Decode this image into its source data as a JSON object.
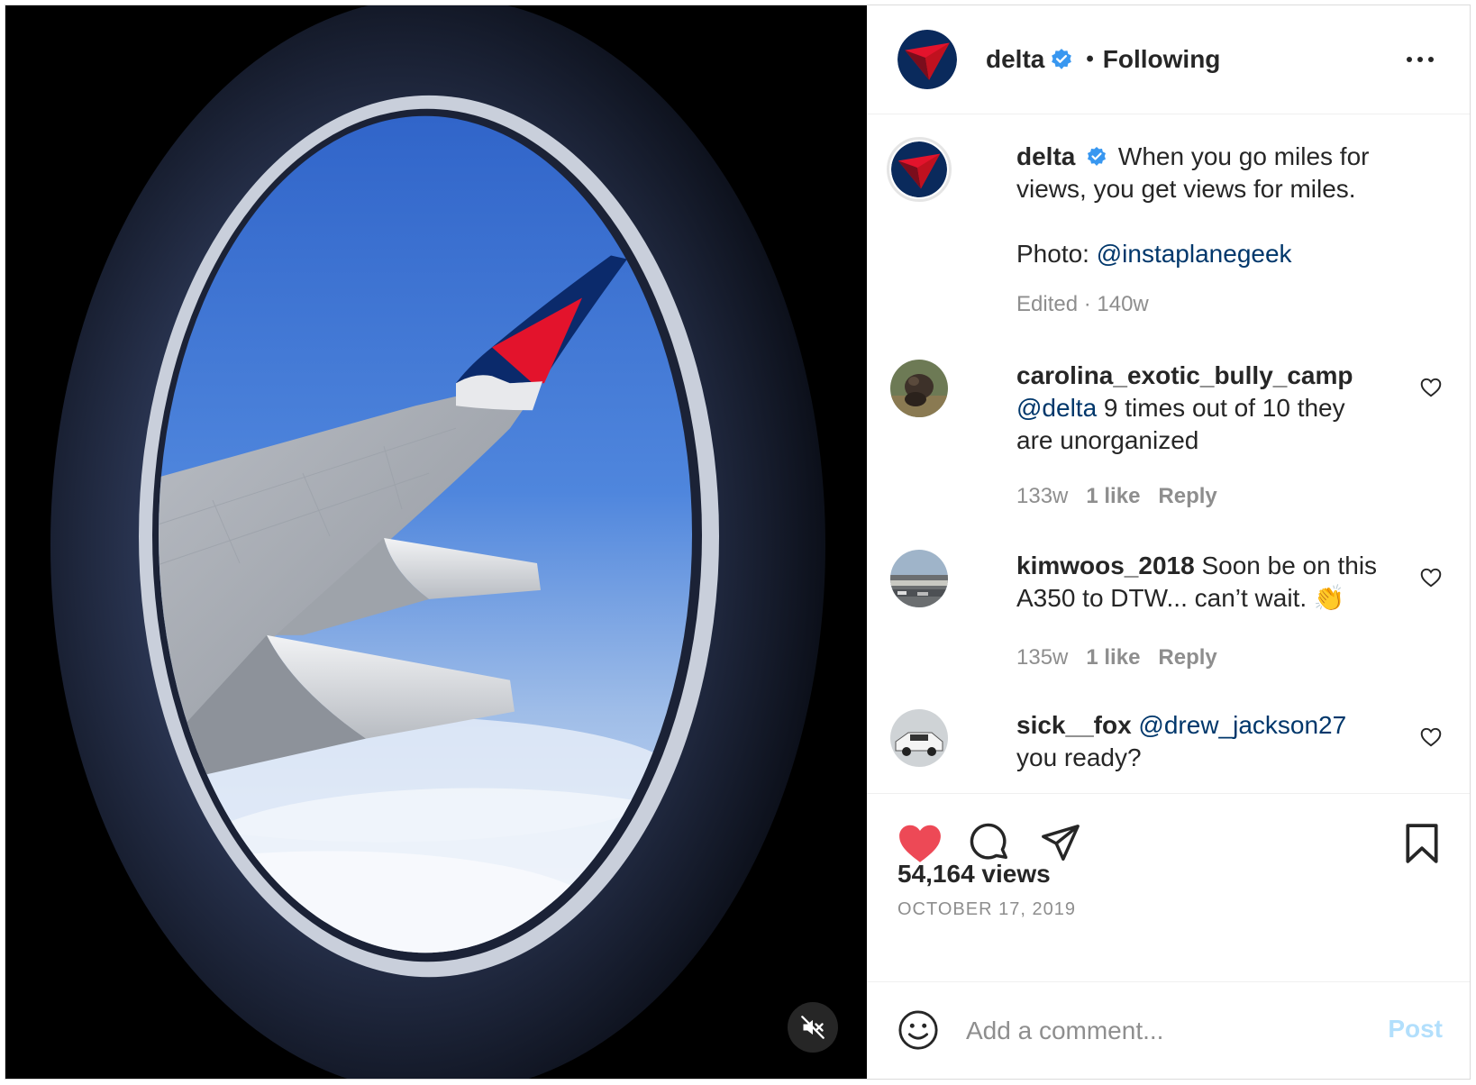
{
  "header": {
    "username": "delta",
    "separator": "•",
    "follow_status": "Following"
  },
  "caption": {
    "username": "delta",
    "text_line1": "When you go miles for",
    "text_line2": "views, you get views for miles.",
    "photo_prefix": "Photo: ",
    "photo_credit": "@instaplanegeek",
    "edited": "Edited · 140w"
  },
  "comments": [
    {
      "username": "carolina_exotic_bully_camp",
      "mention": "@delta",
      "text": " 9 times out of 10 they are unorganized",
      "time": "133w",
      "likes": "1 like",
      "reply": "Reply"
    },
    {
      "username": "kimwoos_2018",
      "text": " Soon be on this A350 to DTW... can’t wait. ",
      "emoji": "👏",
      "time": "135w",
      "likes": "1 like",
      "reply": "Reply"
    },
    {
      "username": "sick__fox",
      "mention": "@drew_jackson27",
      "text": " you ready?"
    }
  ],
  "stats": {
    "views": "54,164 views",
    "date": "OCTOBER 17, 2019"
  },
  "add_comment": {
    "placeholder": "Add a comment...",
    "post_label": "Post"
  },
  "icons": {
    "like": "heart-filled-icon",
    "comment": "speech-bubble-icon",
    "share": "paper-plane-icon",
    "save": "bookmark-icon",
    "mute": "speaker-muted-icon",
    "emoji": "smiley-icon",
    "verified": "verified-badge-icon",
    "more": "ellipsis-icon"
  },
  "colors": {
    "like_red": "#ed4956",
    "mention_blue": "#00376b",
    "verified_blue": "#3897f0",
    "post_button": "#b2dffc",
    "delta_red": "#e3132c",
    "delta_navy": "#003366"
  }
}
